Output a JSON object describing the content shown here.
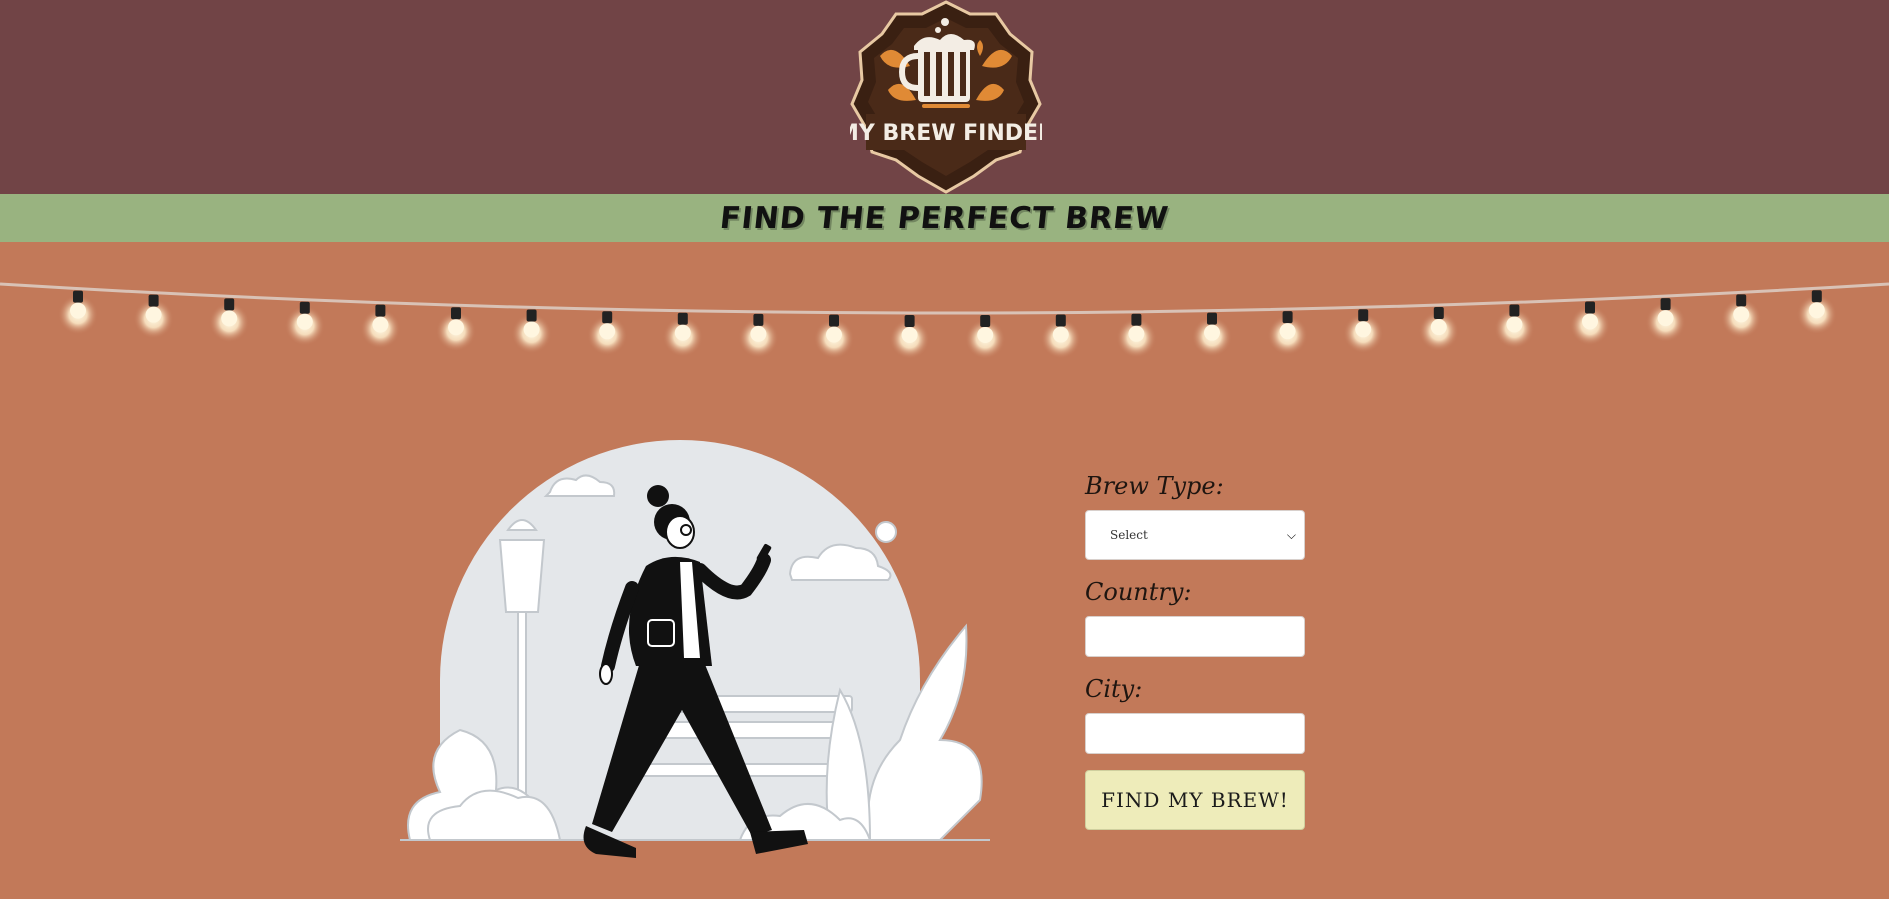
{
  "header": {
    "logo_text": "MY BREW FINDER"
  },
  "tagline": "FIND THE PERFECT BREW",
  "form": {
    "brew_type_label": "Brew Type:",
    "brew_type_selected": "Select",
    "country_label": "Country:",
    "country_value": "",
    "city_label": "City:",
    "city_value": "",
    "submit_label": "FIND MY BREW!"
  },
  "colors": {
    "header_bg": "#714446",
    "tagline_bg": "#99b380",
    "page_bg": "#c27959",
    "button_bg": "#eeecba"
  },
  "icons": {
    "logo": "beer-mug-logo",
    "lights": "string-lights",
    "illustration": "woman-walking-with-phone"
  }
}
